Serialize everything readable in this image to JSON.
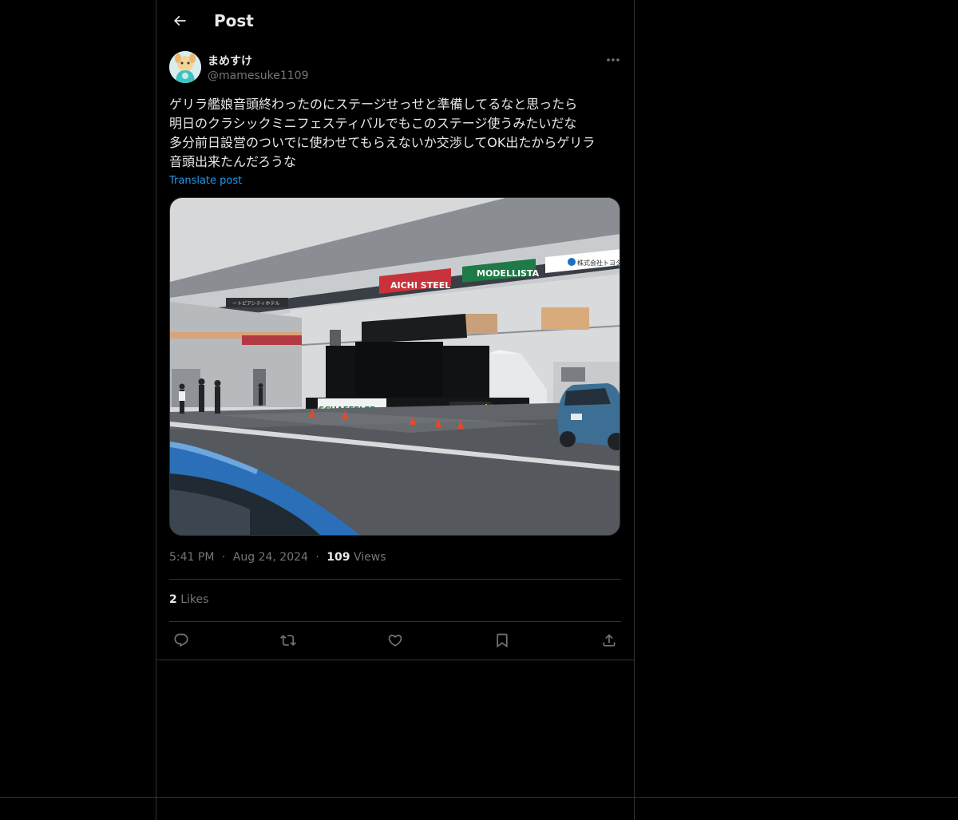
{
  "header": {
    "title": "Post",
    "back_icon": "arrow-left-icon"
  },
  "author": {
    "display_name": "まめすけ",
    "handle": "@mamesuke1109"
  },
  "post": {
    "lines": [
      "ゲリラ艦娘音頭終わったのにステージせっせと準備してるなと思ったら",
      "明日のクラシックミニフェスティバルでもこのステージ使うみたいだな",
      "多分前日設営のついでに使わせてもらえないか交渉してOK出たからゲリラ",
      "音頭出来たんだろうな"
    ],
    "translate_label": "Translate post"
  },
  "media": {
    "signs": {
      "aichi": "AICHI STEEL",
      "modellista": "MODELLISTA",
      "toyota": "株式会社トヨタ",
      "banner": "SCHAEFFLER",
      "building_sign": "ートピアシティホテル"
    }
  },
  "meta": {
    "time": "5:41 PM",
    "sep1": "·",
    "date": "Aug 24, 2024",
    "sep2": "·",
    "views_count": "109",
    "views_label": "Views"
  },
  "stats": {
    "likes_count": "2",
    "likes_label": "Likes"
  },
  "actions": [
    "reply-icon",
    "repost-icon",
    "like-icon",
    "bookmark-icon",
    "share-icon"
  ],
  "colors": {
    "background": "#000000",
    "text": "#e7e9ea",
    "muted": "#71767b",
    "link": "#1d9bf0",
    "border": "#2f3336"
  }
}
